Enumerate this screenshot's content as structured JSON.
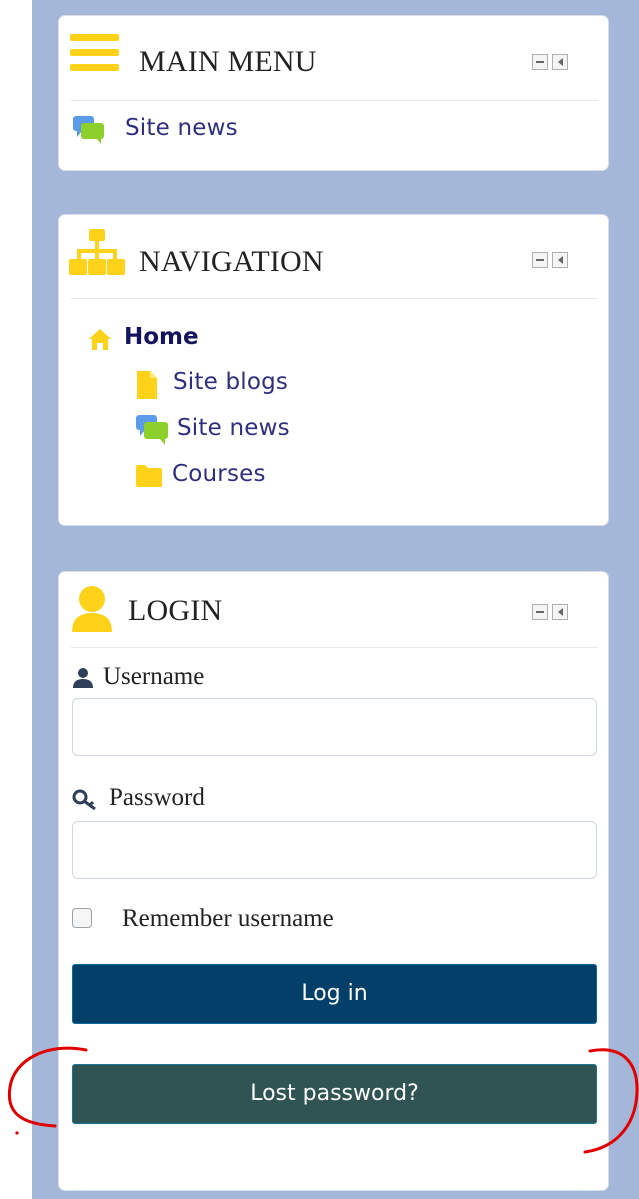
{
  "blocks": {
    "main_menu": {
      "title": "MAIN MENU",
      "items": [
        {
          "label": "Site news",
          "icon": "speech-bubbles-icon"
        }
      ]
    },
    "navigation": {
      "title": "NAVIGATION",
      "home": {
        "label": "Home",
        "icon": "home-icon"
      },
      "items": [
        {
          "label": "Site blogs",
          "icon": "document-icon"
        },
        {
          "label": "Site news",
          "icon": "speech-bubbles-icon"
        },
        {
          "label": "Courses",
          "icon": "folder-icon"
        }
      ]
    },
    "login": {
      "title": "LOGIN",
      "username_label": "Username",
      "password_label": "Password",
      "remember_label": "Remember username",
      "login_button": "Log in",
      "lost_password_button": "Lost password?"
    }
  },
  "colors": {
    "sidebar_background": "#a5b7d9",
    "accent_icon": "#ffd21a",
    "primary_button": "#043f69",
    "secondary_button": "#2f5453",
    "annotation": "#e10000"
  }
}
